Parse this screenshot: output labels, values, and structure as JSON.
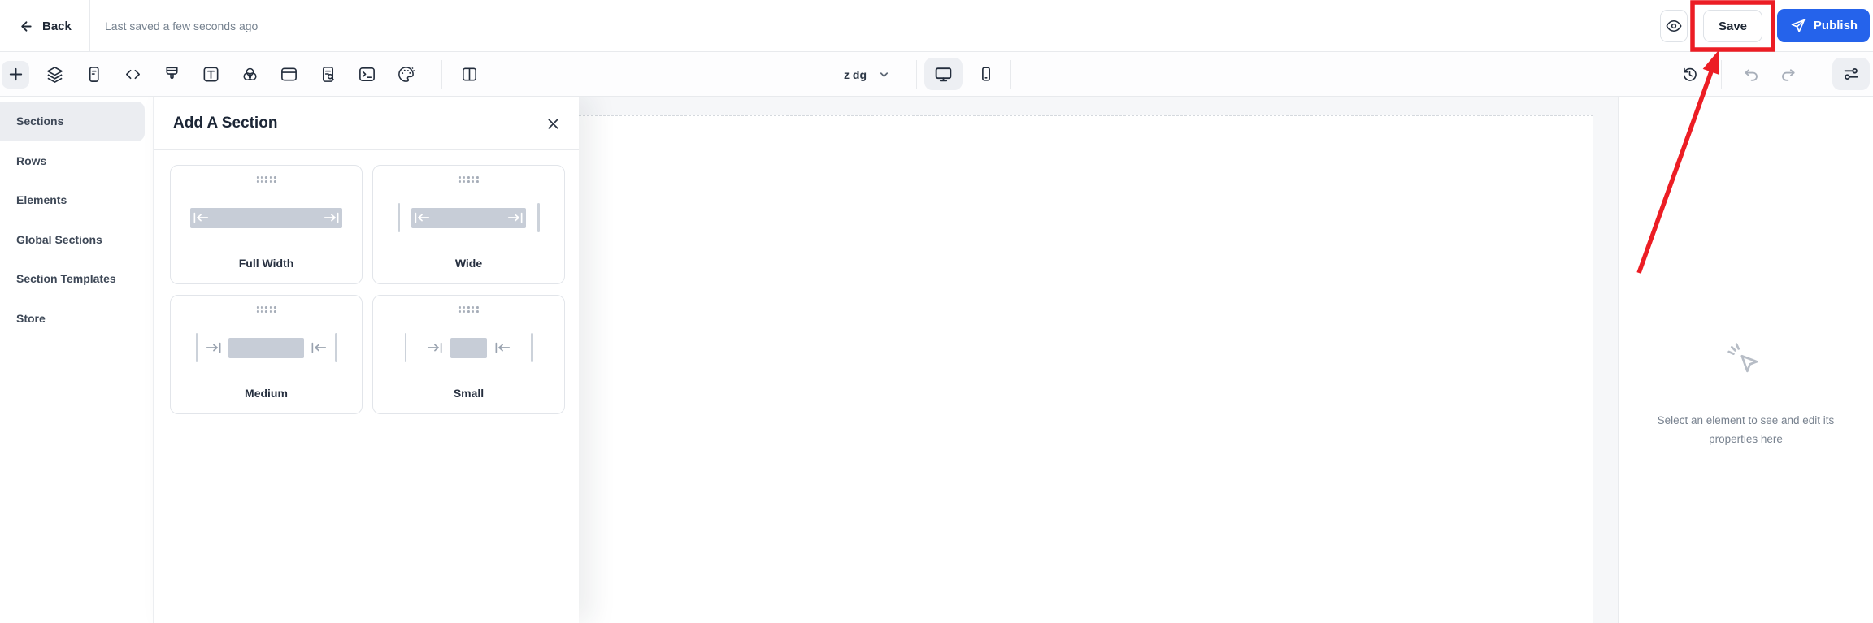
{
  "topbar": {
    "back_label": "Back",
    "last_saved": "Last saved a few seconds ago",
    "save_label": "Save",
    "publish_label": "Publish"
  },
  "toolbar": {
    "zoom_value": "z dg",
    "left_icons": [
      "add",
      "layers",
      "page-content",
      "custom-code",
      "styles-brush",
      "typography",
      "blend",
      "header-section",
      "page-audit",
      "console",
      "theme-palette",
      "split-view"
    ],
    "device_icons": [
      "desktop",
      "mobile"
    ],
    "right_icons": [
      "version-history",
      "undo",
      "redo",
      "settings-sliders"
    ]
  },
  "sidebar": {
    "items": [
      {
        "label": "Sections",
        "active": true
      },
      {
        "label": "Rows",
        "active": false
      },
      {
        "label": "Elements",
        "active": false
      },
      {
        "label": "Global Sections",
        "active": false
      },
      {
        "label": "Section Templates",
        "active": false
      },
      {
        "label": "Store",
        "active": false
      }
    ]
  },
  "add_section_panel": {
    "title": "Add A Section",
    "cards": [
      {
        "label": "Full Width",
        "size": "full-width"
      },
      {
        "label": "Wide",
        "size": "wide"
      },
      {
        "label": "Medium",
        "size": "medium"
      },
      {
        "label": "Small",
        "size": "small"
      }
    ]
  },
  "properties_panel": {
    "empty_state_line1": "Select an element to see and edit its",
    "empty_state_line2": "properties here"
  },
  "annotations": {
    "highlighted_button": "Save",
    "color": "#ec1d24"
  },
  "colors": {
    "publish_blue": "#2563eb",
    "annotation_red": "#ec1d24",
    "canvas_bg": "#f6f7f9",
    "active_item_bg": "#ebedf1",
    "icon_dark": "#2a3444",
    "muted_text": "#76828f"
  }
}
